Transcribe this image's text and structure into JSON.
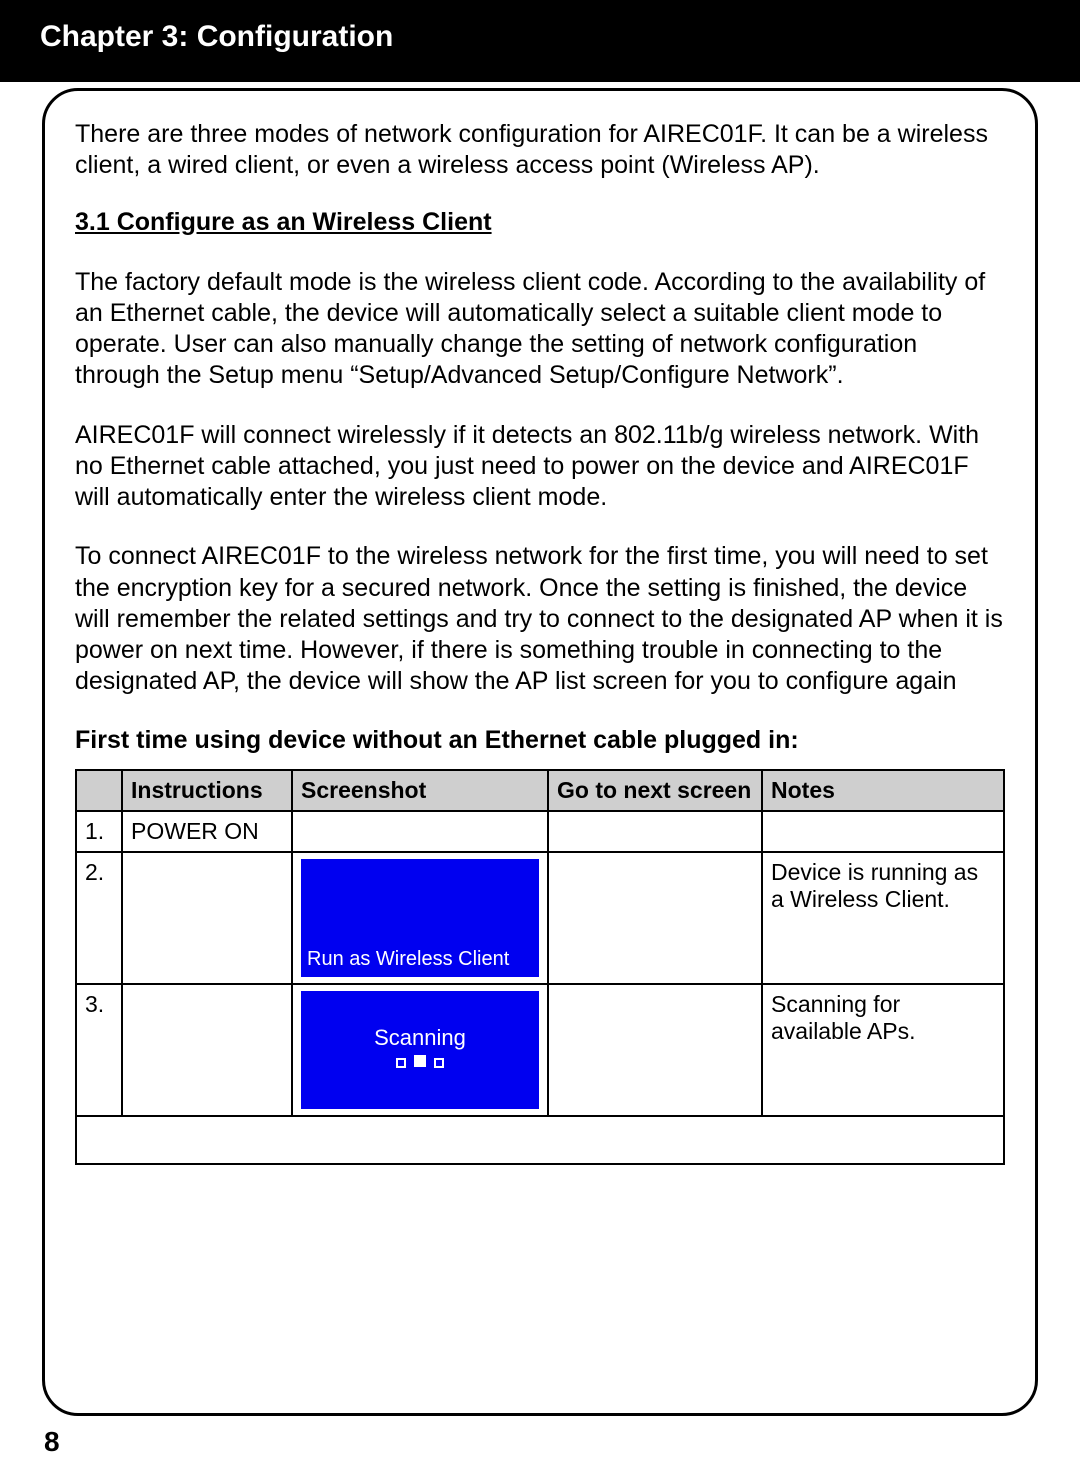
{
  "header": {
    "title": "Chapter 3: Configuration"
  },
  "intro": "There are three modes of network configuration for AIREC01F. It can be a wireless client, a wired client, or even a wireless access point (Wireless AP).",
  "section_heading": "3.1 Configure as an Wireless Client",
  "para1": "The factory default mode is the wireless client code. According to the availability of an Ethernet cable, the device will automatically select a suitable client mode to operate. User can also manually change the setting of network configuration through the Setup menu “Setup/Advanced Setup/Configure Network”.",
  "para2": "AIREC01F will connect wirelessly if it detects an 802.11b/g wireless network. With no Ethernet cable attached, you just need to power on the device and AIREC01F will automatically enter the wireless client mode.",
  "para3": "To connect AIREC01F to the wireless network for the first time, you will need to set the encryption key for a secured network. Once the setting is finished, the device will remember the related settings and try to connect to the designated AP when it is power on next time. However, if there is something trouble in connecting to the designated AP, the device will show the AP list screen for you to configure again",
  "sub_heading": "First time using device without an Ethernet cable plugged in:",
  "table": {
    "headers": {
      "num": "",
      "instructions": "Instructions",
      "screenshot": "Screenshot",
      "next": "Go to next screen",
      "notes": "Notes"
    },
    "rows": [
      {
        "num": "1.",
        "instructions": "POWER ON",
        "screenshot_text": "",
        "screenshot_secondary": "",
        "next": "",
        "notes": ""
      },
      {
        "num": "2.",
        "instructions": "",
        "screenshot_text": "Run as Wireless Client",
        "screenshot_secondary": "",
        "next": "",
        "notes": "Device is running as a Wireless Client."
      },
      {
        "num": "3.",
        "instructions": "",
        "screenshot_text": "Scanning",
        "screenshot_secondary": "indicators",
        "next": "",
        "notes": "Scanning for available APs."
      }
    ]
  },
  "page_number": "8"
}
